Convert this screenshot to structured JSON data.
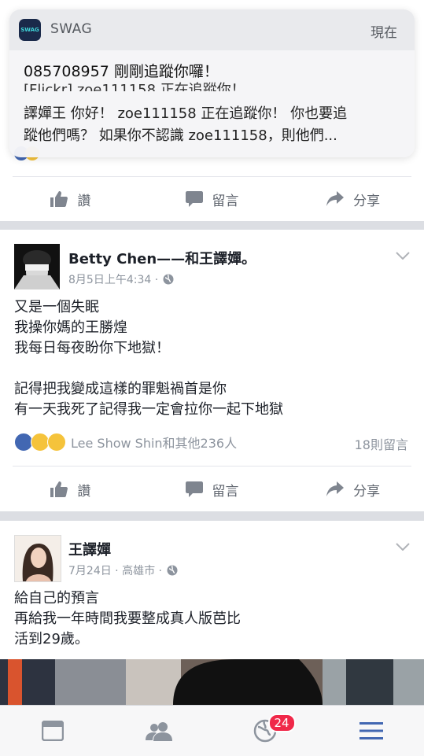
{
  "notification": {
    "app_name": "SWAG",
    "app_icon_text": "SWAG",
    "time": "現在",
    "message": "085708957 剛剛追蹤你囉！",
    "preview_line1": "[Flickr] zoe111158 正在追蹤你！",
    "preview_line2": "譯嬋王 你好！ zoe111158 正在追蹤你！ 你也要追",
    "preview_line3": "蹤他們嗎？ 如果你不認識 zoe111158，則他們..."
  },
  "top_card": {
    "like": "讚",
    "comment": "留言",
    "share": "分享"
  },
  "post1": {
    "author": "Betty Chen——和王譯嬋。",
    "meta": "8月5日上午4:34 ·",
    "text": "又是一個失眠\n我操你媽的王勝煌\n我每日每夜盼你下地獄！\n\n記得把我變成這樣的罪魁禍首是你\n有一天我死了記得我一定會拉你一起下地獄",
    "reactions_text": "Lee Show Shin和其他236人",
    "comments_count": "18則留言",
    "like": "讚",
    "comment": "留言",
    "share": "分享"
  },
  "post2": {
    "author": "王譯嬋",
    "meta": "7月24日 · 高雄市 ·",
    "text": "給自己的預言\n再給我一年時間我要整成真人版芭比\n活到29歲。"
  },
  "tabbar": {
    "notifications_badge": "24"
  },
  "colors": {
    "facebook_blue": "#4267b2",
    "badge_red": "#f02849",
    "meta_gray": "#8d949e"
  }
}
